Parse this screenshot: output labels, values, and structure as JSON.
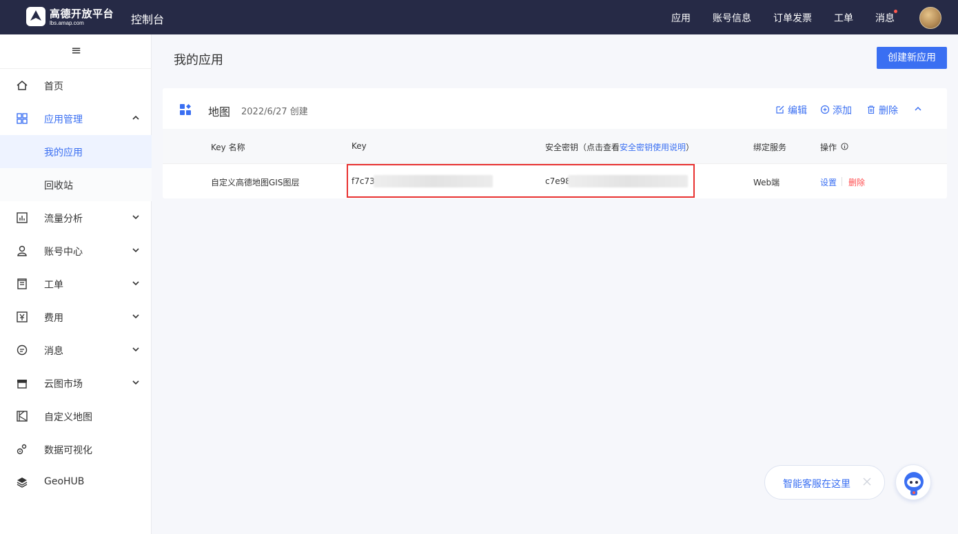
{
  "header": {
    "brand_title": "高德开放平台",
    "brand_sub": "lbs.amap.com",
    "console": "控制台",
    "nav": [
      "应用",
      "账号信息",
      "订单发票",
      "工单",
      "消息"
    ]
  },
  "sidebar": {
    "items": [
      {
        "label": "首页",
        "icon": "home-icon"
      },
      {
        "label": "应用管理",
        "icon": "grid-icon"
      },
      {
        "label": "我的应用"
      },
      {
        "label": "回收站"
      },
      {
        "label": "流量分析",
        "icon": "chart-icon"
      },
      {
        "label": "账号中心",
        "icon": "user-icon"
      },
      {
        "label": "工单",
        "icon": "ticket-icon"
      },
      {
        "label": "费用",
        "icon": "yuan-icon"
      },
      {
        "label": "消息",
        "icon": "message-icon"
      },
      {
        "label": "云图市场",
        "icon": "store-icon"
      },
      {
        "label": "自定义地图",
        "icon": "map-icon"
      },
      {
        "label": "数据可视化",
        "icon": "visualization-icon"
      },
      {
        "label": "GeoHUB",
        "icon": "layers-icon"
      }
    ]
  },
  "main": {
    "title": "我的应用",
    "create_label": "创建新应用",
    "app": {
      "name": "地图",
      "created": "2022/6/27 创建",
      "actions": {
        "edit": "编辑",
        "add": "添加",
        "delete": "删除"
      },
      "columns": {
        "key_name": "Key 名称",
        "key": "Key",
        "secret_prefix": "安全密钥（点击查看",
        "secret_link": "安全密钥使用说明",
        "secret_suffix": "）",
        "service": "绑定服务",
        "ops": "操作"
      },
      "row": {
        "key_name": "自定义高德地图GIS图层",
        "key": "f7c73",
        "secret": "c7e98",
        "service": "Web端",
        "settings": "设置",
        "delete": "删除"
      }
    }
  },
  "service_widget": {
    "label": "智能客服在这里"
  },
  "colors": {
    "primary": "#3a6ff2",
    "header": "#262a46",
    "danger": "#ff4d4f",
    "highlight": "#e8302f"
  }
}
